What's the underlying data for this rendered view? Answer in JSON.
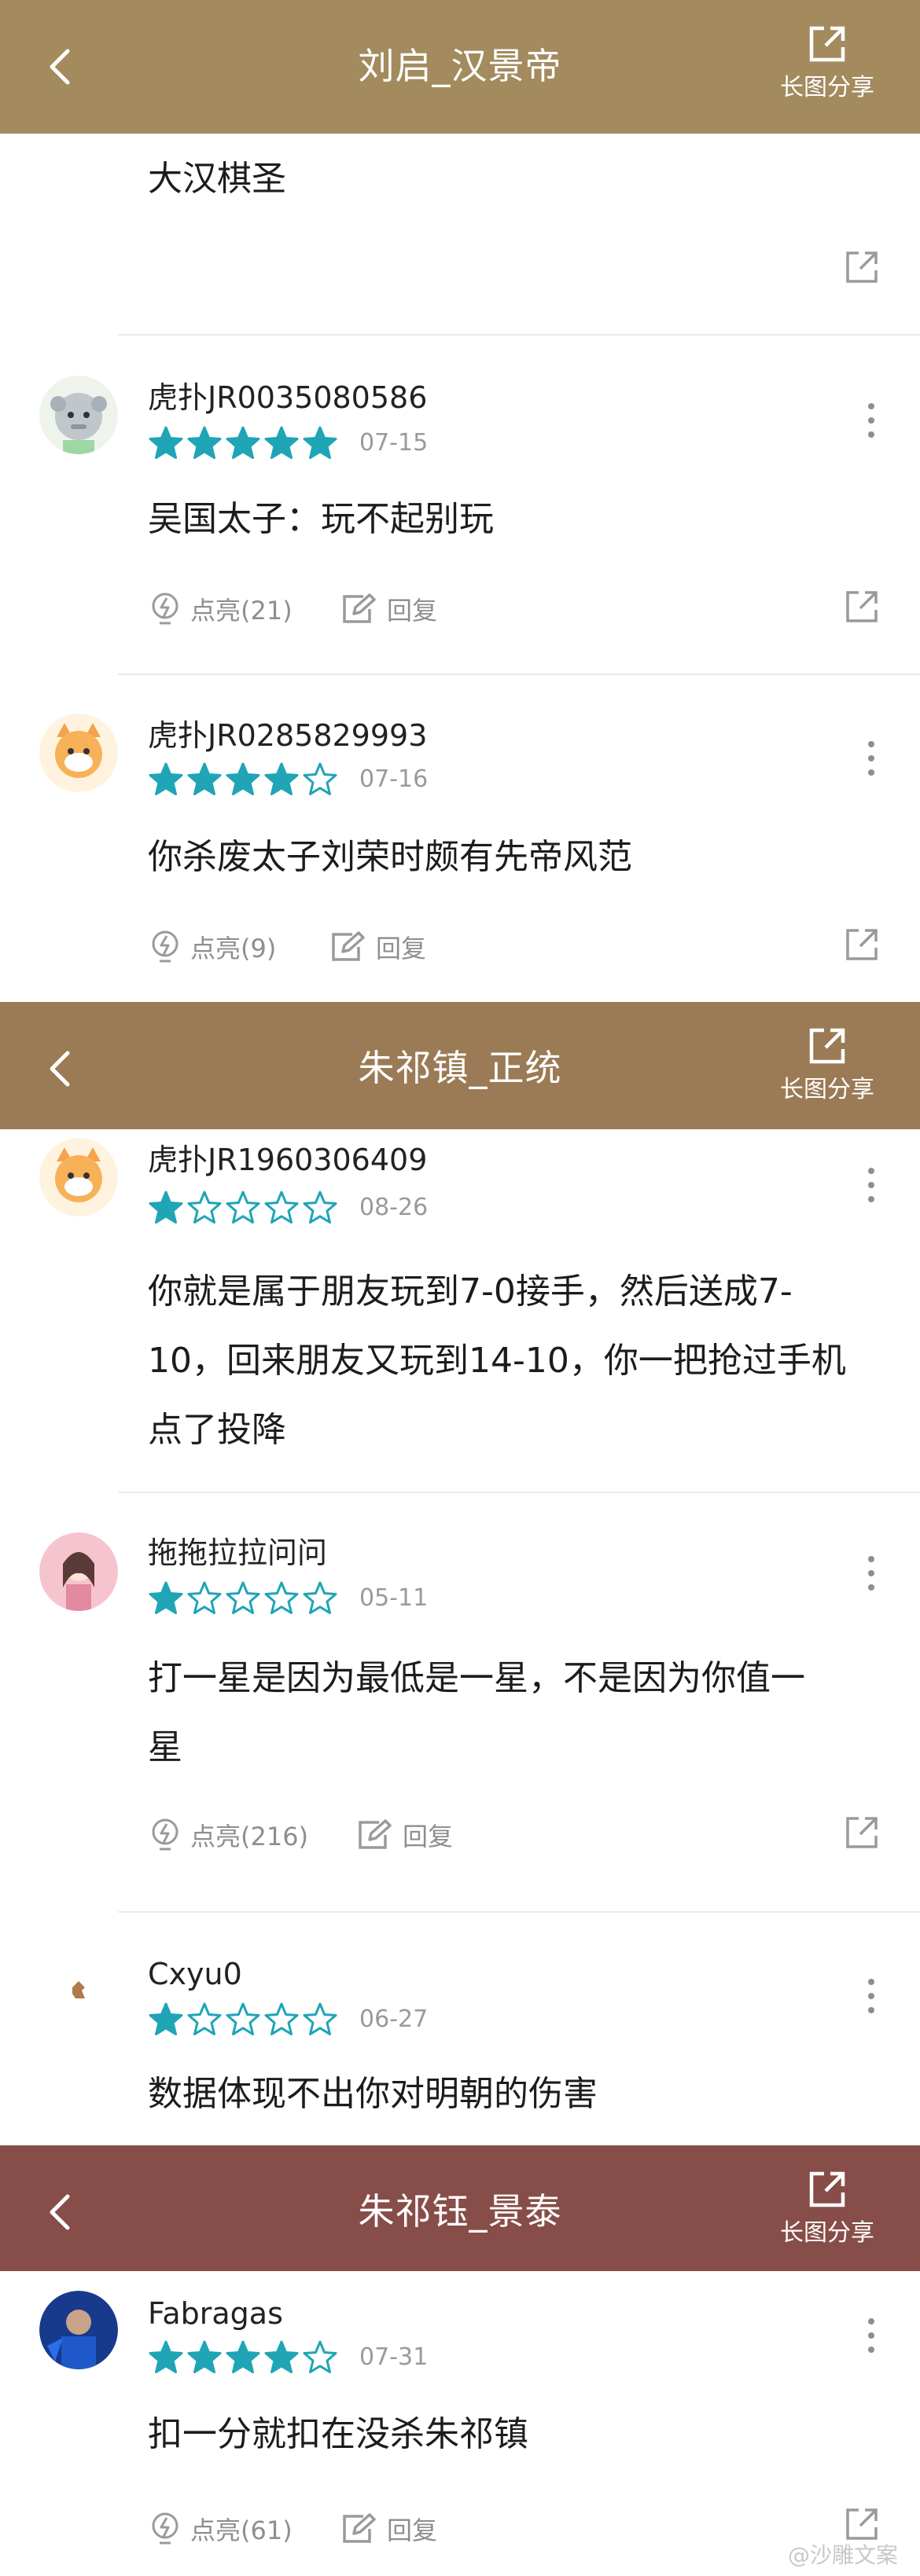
{
  "headers": [
    {
      "back_icon": "chevron-left-icon",
      "title": "刘启_汉景帝",
      "share_label": "长图分享",
      "share_icon": "share-external-icon",
      "bg": "#A38B5E"
    },
    {
      "back_icon": "chevron-left-icon",
      "title": "朱祁镇_正统",
      "share_label": "长图分享",
      "share_icon": "share-external-icon",
      "bg": "#9A7B55"
    },
    {
      "back_icon": "chevron-left-icon",
      "title": "朱祁钰_景泰",
      "share_label": "长图分享",
      "share_icon": "share-external-icon",
      "bg": "#874D48"
    }
  ],
  "comments": [
    {
      "text": "大汉棋圣"
    },
    {
      "user": "虎扑JR0035080586",
      "rating": 5,
      "date": "07-15",
      "text": "吴国太子：玩不起别玩",
      "like_label": "点亮(21)",
      "reply_label": "回复"
    },
    {
      "user": "虎扑JR0285829993",
      "rating": 4,
      "date": "07-16",
      "text": "你杀废太子刘荣时颇有先帝风范",
      "like_label": "点亮(9)",
      "reply_label": "回复"
    },
    {
      "user": "虎扑JR1960306409",
      "rating": 1,
      "date": "08-26",
      "text_lines": [
        "你就是属于朋友玩到7-0接手，然后送成7-",
        "10，回来朋友又玩到14-10，你一把抢过手机",
        "点了投降"
      ]
    },
    {
      "user": "拖拖拉拉问问",
      "rating": 1,
      "date": "05-11",
      "text_lines": [
        "打一星是因为最低是一星，不是因为你值一",
        "星"
      ],
      "like_label": "点亮(216)",
      "reply_label": "回复"
    },
    {
      "user": "Cxyu0",
      "rating": 1,
      "date": "06-27",
      "text": "数据体现不出你对明朝的伤害"
    },
    {
      "user": "Fabragas",
      "rating": 4,
      "date": "07-31",
      "text": "扣一分就扣在没杀朱祁镇",
      "like_label": "点亮(61)",
      "reply_label": "回复"
    }
  ],
  "watermark": "@沙雕文案",
  "colors": {
    "star": "#1FA5B6",
    "star_empty": "#1FA5B6",
    "muted": "#9A9A9A"
  }
}
